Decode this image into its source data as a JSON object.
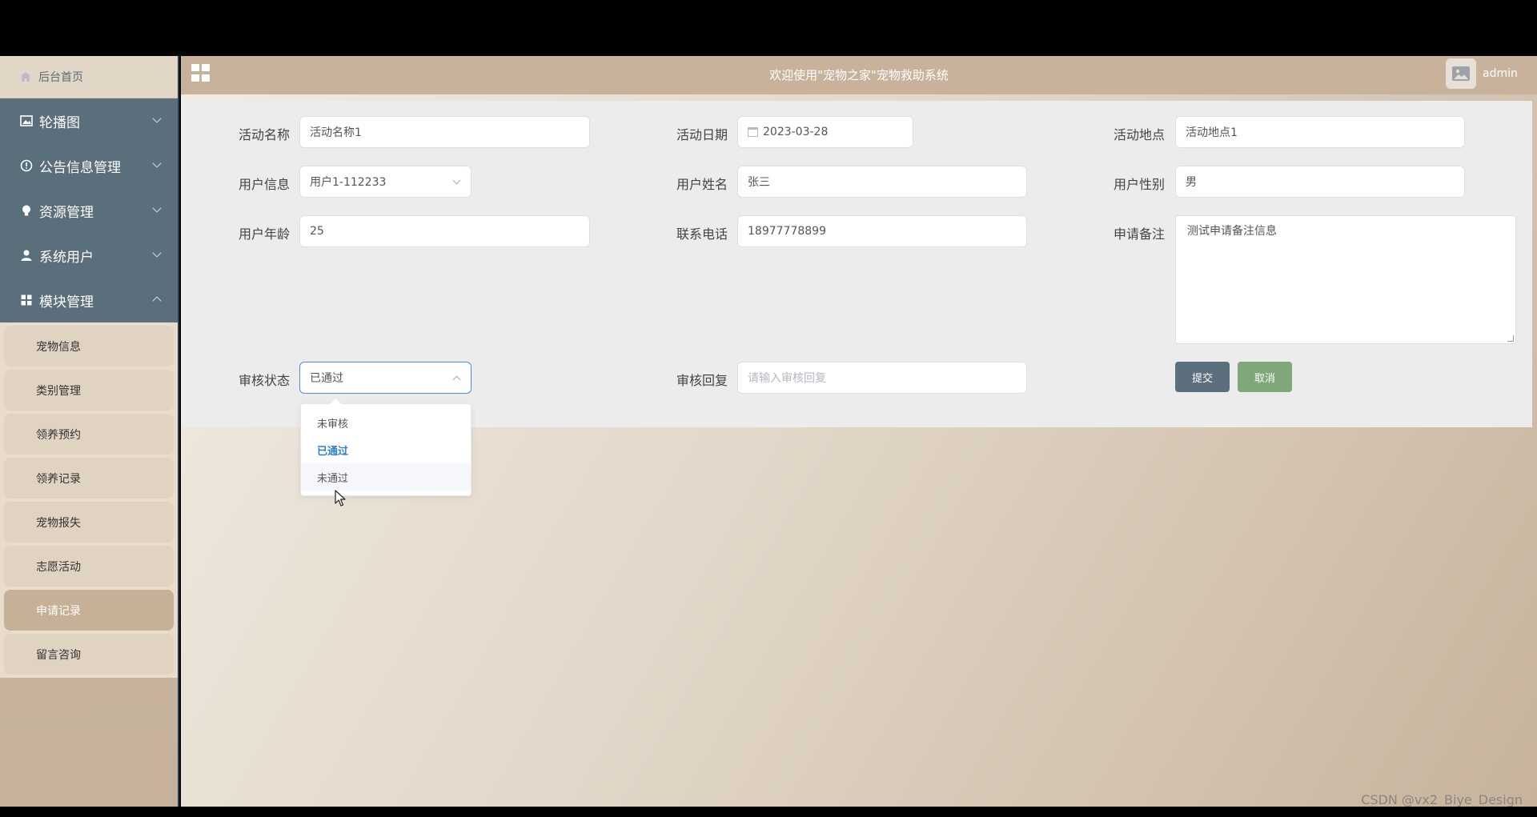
{
  "sidebar": {
    "home": "后台首页",
    "menus": [
      {
        "label": "轮播图",
        "icon": "image-icon",
        "expanded": false
      },
      {
        "label": "公告信息管理",
        "icon": "info-icon",
        "expanded": false
      },
      {
        "label": "资源管理",
        "icon": "lightbulb-icon",
        "expanded": false
      },
      {
        "label": "系统用户",
        "icon": "user-icon",
        "expanded": false
      },
      {
        "label": "模块管理",
        "icon": "grid-icon",
        "expanded": true
      }
    ],
    "sub_items": [
      "宠物信息",
      "类别管理",
      "领养预约",
      "领养记录",
      "宠物报失",
      "志愿活动",
      "申请记录",
      "留言咨询"
    ],
    "active_sub": "申请记录"
  },
  "header": {
    "title": "欢迎使用\"宠物之家\"宠物救助系统",
    "username": "admin"
  },
  "form": {
    "activity_name": {
      "label": "活动名称",
      "value": "活动名称1"
    },
    "activity_date": {
      "label": "活动日期",
      "value": "2023-03-28"
    },
    "activity_place": {
      "label": "活动地点",
      "value": "活动地点1"
    },
    "user_info": {
      "label": "用户信息",
      "value": "用户1-112233"
    },
    "user_name": {
      "label": "用户姓名",
      "value": "张三"
    },
    "user_gender": {
      "label": "用户性别",
      "value": "男"
    },
    "user_age": {
      "label": "用户年龄",
      "value": "25"
    },
    "phone": {
      "label": "联系电话",
      "value": "18977778899"
    },
    "remark": {
      "label": "申请备注",
      "value": "测试申请备注信息"
    },
    "review_status": {
      "label": "审核状态",
      "value": "已通过"
    },
    "review_reply": {
      "label": "审核回复",
      "placeholder": "请输入审核回复"
    },
    "submit": "提交",
    "cancel": "取消"
  },
  "dropdown": {
    "options": [
      "未审核",
      "已通过",
      "未通过"
    ],
    "selected": "已通过",
    "hovered": "未通过"
  },
  "watermark": "CSDN @vx2_Biye_Design",
  "colors": {
    "sidebar_menu": "#5b6e7b",
    "header": "#c8b29b",
    "active_item": "#c7b098",
    "submit": "#5c6f7c",
    "cancel": "#7fa77a",
    "selected_option": "#2f7fd1"
  }
}
